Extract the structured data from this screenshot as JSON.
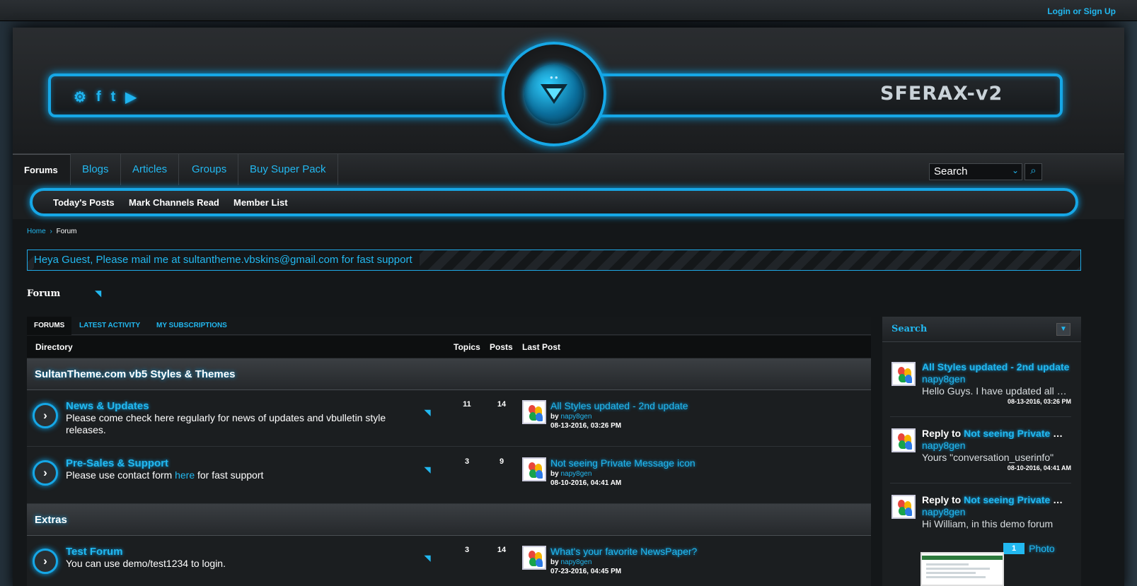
{
  "top": {
    "login": "Login or Sign Up"
  },
  "header": {
    "site_title": "SFERAX-v2",
    "social": [
      "steam-icon",
      "facebook-icon",
      "twitter-icon",
      "youtube-icon"
    ],
    "social_glyphs": [
      "⚙",
      "f",
      "t",
      "▶"
    ]
  },
  "nav": {
    "tabs": [
      "Forums",
      "Blogs",
      "Articles",
      "Groups",
      "Buy Super Pack"
    ],
    "search_value": "Search"
  },
  "subnav": {
    "links": [
      "Today's Posts",
      "Mark Channels Read",
      "Member List"
    ]
  },
  "breadcrumb": {
    "home": "Home",
    "sep": "›",
    "current": "Forum"
  },
  "notice": "Heya Guest, Please mail me at sultantheme.vbskins@gmail.com for fast support",
  "page": {
    "title": "Forum"
  },
  "tabs": [
    "FORUMS",
    "LATEST ACTIVITY",
    "MY SUBSCRIPTIONS"
  ],
  "columns": {
    "directory": "Directory",
    "topics": "Topics",
    "posts": "Posts",
    "last_post": "Last Post"
  },
  "categories": [
    {
      "name": "SultanTheme.com vb5 Styles & Themes",
      "forums": [
        {
          "title": "News & Updates",
          "desc": "Please come check here regularly for news of updates and vbulletin style releases.",
          "topics": "11",
          "posts": "14",
          "last_title": "All Styles updated - 2nd update",
          "last_by": "by",
          "last_user": "napy8gen",
          "last_date": "08-13-2016, 03:26 PM"
        },
        {
          "title": "Pre-Sales & Support",
          "desc_pre": "Please use contact form ",
          "desc_link": "here",
          "desc_post": " for fast support",
          "topics": "3",
          "posts": "9",
          "last_title": "Not seeing Private Message icon",
          "last_by": "by",
          "last_user": "napy8gen",
          "last_date": "08-10-2016, 04:41 AM"
        }
      ]
    },
    {
      "name": "Extras",
      "forums": [
        {
          "title": "Test Forum",
          "desc": "You can use demo/test1234 to login.",
          "topics": "3",
          "posts": "14",
          "last_title": "What's your favorite NewsPaper?",
          "last_by": "by",
          "last_user": "napy8gen",
          "last_date": "07-23-2016, 04:45 PM"
        }
      ]
    }
  ],
  "sidebar": {
    "title": "Search",
    "items": [
      {
        "prefix": "",
        "title": "All Styles updated - 2nd update",
        "user": "napy8gen",
        "excerpt": "Hello Guys. I have updated all styles",
        "date": "08-13-2016, 03:26 PM"
      },
      {
        "prefix": "Reply to ",
        "title": "Not seeing Private Message icon",
        "user": "napy8gen",
        "excerpt": "Yours \"conversation_userinfo\"",
        "date": "08-10-2016, 04:41 AM"
      },
      {
        "prefix": "Reply to ",
        "title": "Not seeing Private Message icon",
        "user": "napy8gen",
        "excerpt": "Hi William, in this demo forum",
        "photo_count": "1",
        "photo_label": "Photo"
      }
    ]
  },
  "colors": {
    "accent": "#22b8f0",
    "glow": "#0aa3e8",
    "bg": "#141719"
  }
}
